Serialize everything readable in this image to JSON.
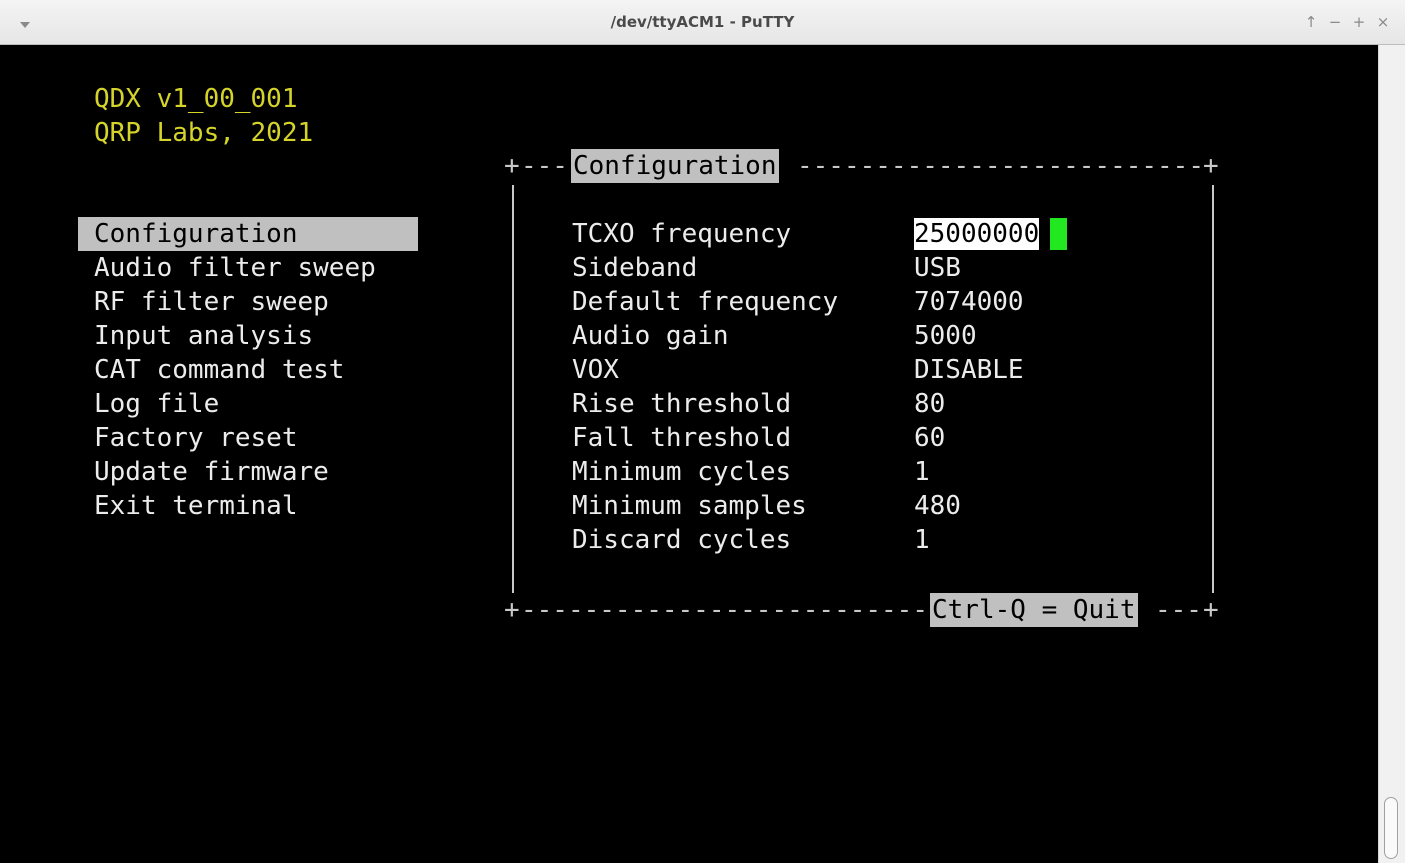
{
  "window": {
    "title": "/dev/ttyACM1 - PuTTY",
    "controls": {
      "menu": "▾",
      "up": "↑",
      "minimize": "−",
      "maximize": "+",
      "close": "×"
    }
  },
  "header": {
    "line1": "QDX v1_00_001",
    "line2": "QRP Labs, 2021"
  },
  "menu": {
    "items": [
      {
        "label": "Configuration",
        "selected": true
      },
      {
        "label": "Audio filter sweep"
      },
      {
        "label": "RF filter sweep"
      },
      {
        "label": "Input analysis"
      },
      {
        "label": "CAT command test"
      },
      {
        "label": "Log file"
      },
      {
        "label": "Factory reset"
      },
      {
        "label": "Update firmware"
      },
      {
        "label": "Exit terminal"
      }
    ]
  },
  "config_box": {
    "title": "Configuration",
    "footer": "Ctrl-Q = Quit",
    "corner": "+",
    "rows": [
      {
        "label": "TCXO frequency",
        "value": "25000000",
        "editing": true
      },
      {
        "label": "Sideband",
        "value": "USB"
      },
      {
        "label": "Default frequency",
        "value": "7074000"
      },
      {
        "label": "Audio gain",
        "value": "5000"
      },
      {
        "label": "VOX",
        "value": "DISABLE"
      },
      {
        "label": "Rise threshold",
        "value": "80"
      },
      {
        "label": "Fall threshold",
        "value": "60"
      },
      {
        "label": "Minimum cycles",
        "value": "1"
      },
      {
        "label": "Minimum samples",
        "value": "480"
      },
      {
        "label": "Discard cycles",
        "value": "1"
      }
    ]
  },
  "colors": {
    "header_text": "#d4d42a",
    "cursor": "#21e821",
    "highlight_bg": "#c0c0c0"
  }
}
